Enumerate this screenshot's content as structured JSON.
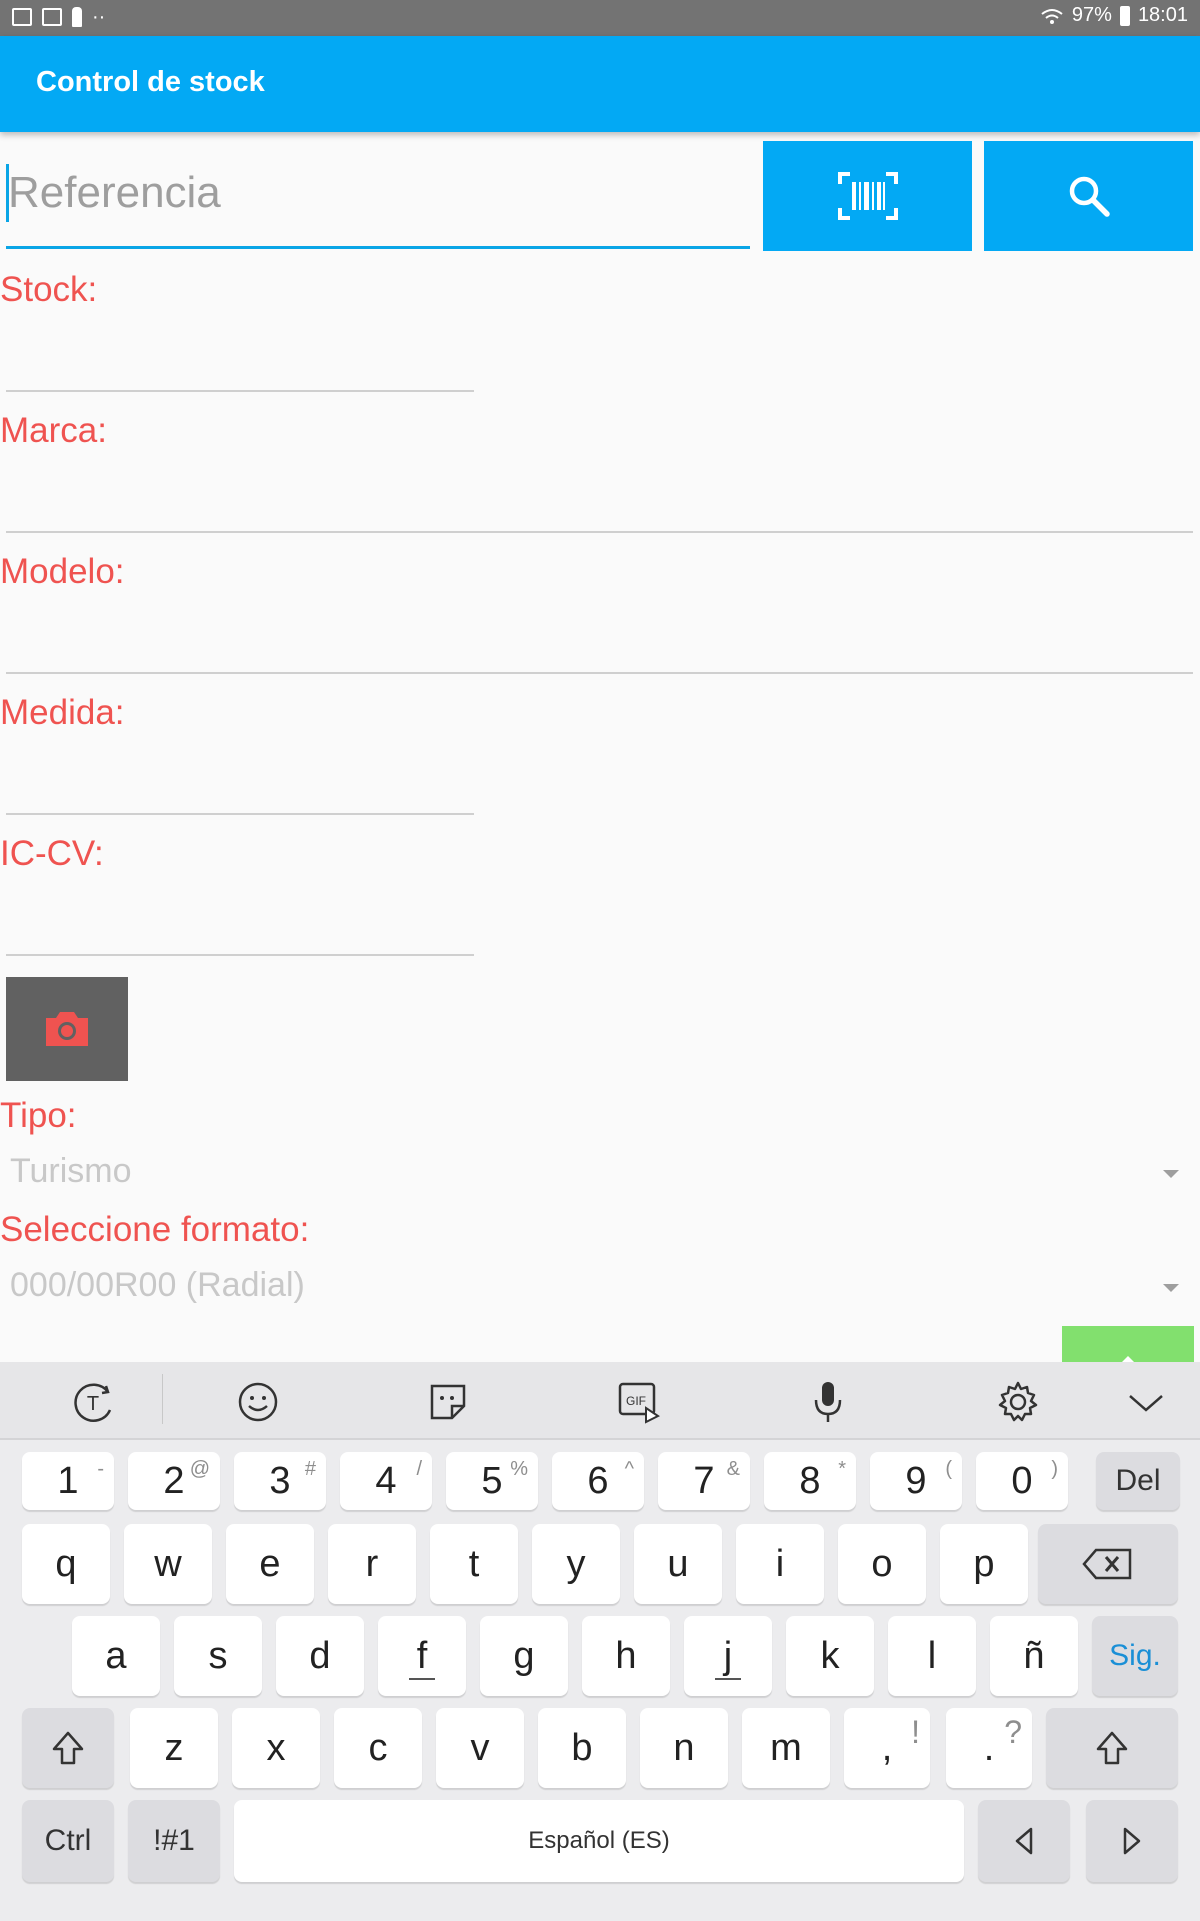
{
  "status_bar": {
    "battery": "97%",
    "time": "18:01"
  },
  "app_bar": {
    "title": "Control de stock"
  },
  "search": {
    "placeholder": "Referencia"
  },
  "form": {
    "stock_label": "Stock:",
    "marca_label": "Marca:",
    "modelo_label": "Modelo:",
    "medida_label": "Medida:",
    "iccv_label": "IC-CV:",
    "tipo_label": "Tipo:",
    "tipo_value": "Turismo",
    "formato_label": "Seleccione formato:",
    "formato_value": "000/00R00 (Radial)"
  },
  "colors": {
    "app_bar": "#03a9f4",
    "label": "#ef5350",
    "camera_button": "#616161",
    "camera_icon": "#ef5350",
    "action_green": "#82e06e"
  },
  "keyboard": {
    "toolbar_icons": [
      "text-mode-icon",
      "emoji-icon",
      "sticker-icon",
      "gif-icon",
      "microphone-icon",
      "settings-icon",
      "collapse-icon"
    ],
    "number_row": [
      {
        "main": "1",
        "sub": "-"
      },
      {
        "main": "2",
        "sub": "@"
      },
      {
        "main": "3",
        "sub": "#"
      },
      {
        "main": "4",
        "sub": "/"
      },
      {
        "main": "5",
        "sub": "%"
      },
      {
        "main": "6",
        "sub": "^"
      },
      {
        "main": "7",
        "sub": "&"
      },
      {
        "main": "8",
        "sub": "*"
      },
      {
        "main": "9",
        "sub": "("
      },
      {
        "main": "0",
        "sub": ")"
      }
    ],
    "del_label": "Del",
    "row_q": [
      "q",
      "w",
      "e",
      "r",
      "t",
      "y",
      "u",
      "i",
      "o",
      "p"
    ],
    "row_a": [
      "a",
      "s",
      "d",
      "f",
      "g",
      "h",
      "j",
      "k",
      "l",
      "ñ"
    ],
    "sig_label": "Sig.",
    "row_z": [
      "z",
      "x",
      "c",
      "v",
      "b",
      "n",
      "m"
    ],
    "comma": {
      "main": ",",
      "sub": "!"
    },
    "period": {
      "main": ".",
      "sub": "?"
    },
    "ctrl_label": "Ctrl",
    "symbols_label": "!#1",
    "space_label": "Español (ES)"
  }
}
